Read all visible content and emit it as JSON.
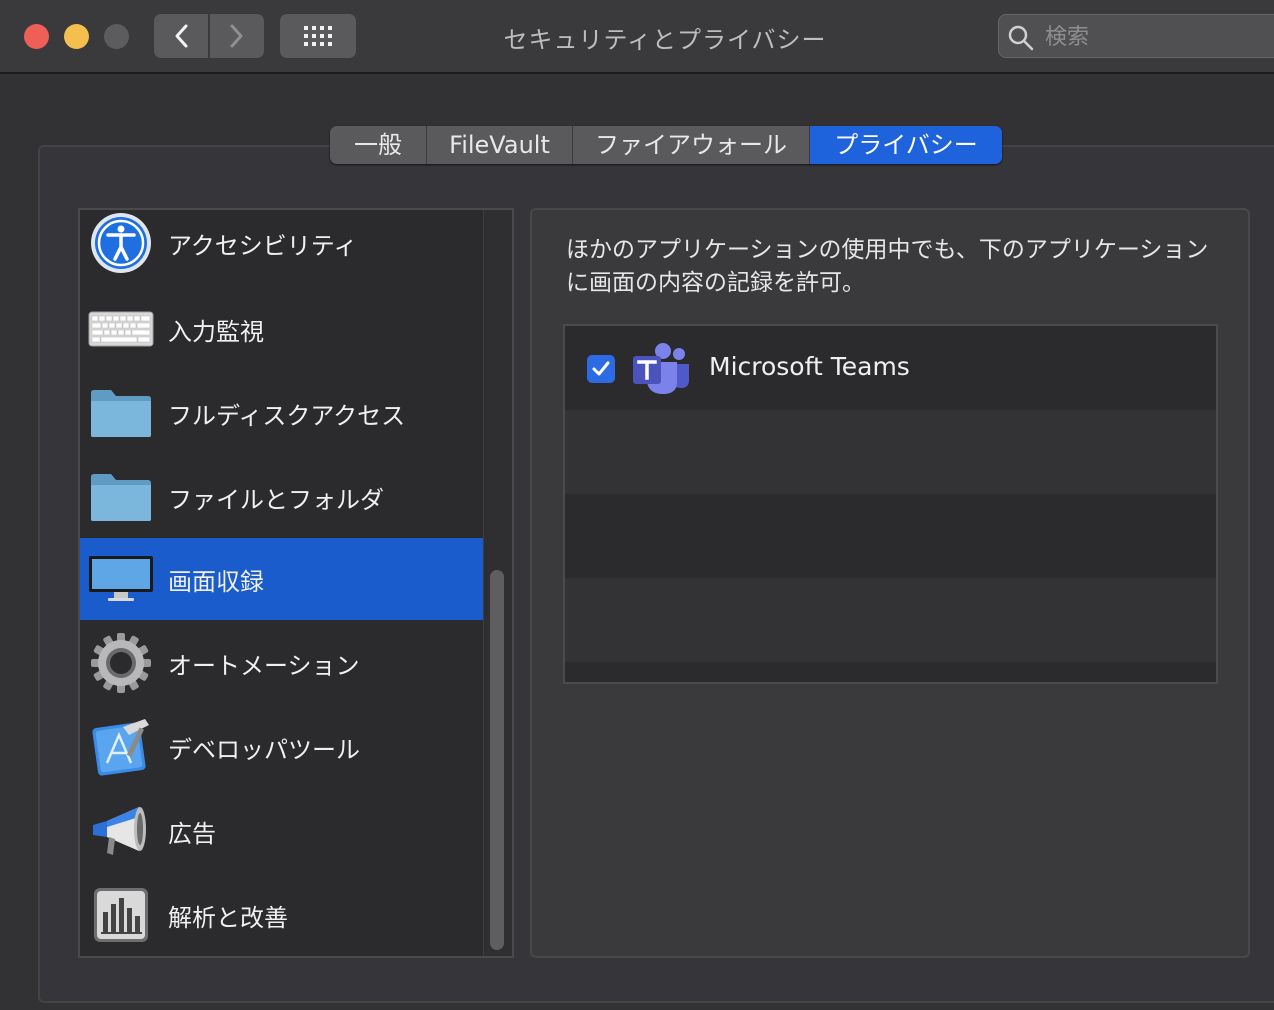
{
  "window": {
    "title": "セキュリティとプライバシー",
    "search_placeholder": "検索"
  },
  "tabs": [
    {
      "label": "一般",
      "active": false
    },
    {
      "label": "FileVault",
      "active": false
    },
    {
      "label": "ファイアウォール",
      "active": false
    },
    {
      "label": "プライバシー",
      "active": true
    }
  ],
  "sidebar": {
    "items": [
      {
        "label": "アクセシビリティ",
        "icon": "accessibility-icon",
        "selected": false
      },
      {
        "label": "入力監視",
        "icon": "keyboard-icon",
        "selected": false
      },
      {
        "label": "フルディスクアクセス",
        "icon": "folder-icon",
        "selected": false
      },
      {
        "label": "ファイルとフォルダ",
        "icon": "folder-icon",
        "selected": false
      },
      {
        "label": "画面収録",
        "icon": "display-icon",
        "selected": true
      },
      {
        "label": "オートメーション",
        "icon": "gear-icon",
        "selected": false
      },
      {
        "label": "デベロッパツール",
        "icon": "xcode-icon",
        "selected": false
      },
      {
        "label": "広告",
        "icon": "megaphone-icon",
        "selected": false
      },
      {
        "label": "解析と改善",
        "icon": "bar-chart-icon",
        "selected": false
      }
    ]
  },
  "main": {
    "description": "ほかのアプリケーションの使用中でも、下のアプリケーションに画面の内容の記録を許可。",
    "apps": [
      {
        "name": "Microsoft Teams",
        "checked": true,
        "icon": "teams-icon"
      }
    ]
  },
  "colors": {
    "accent": "#1f63dc",
    "selection": "#1b5ccc",
    "close": "#ee5f57",
    "minimize": "#f4bf4f"
  }
}
